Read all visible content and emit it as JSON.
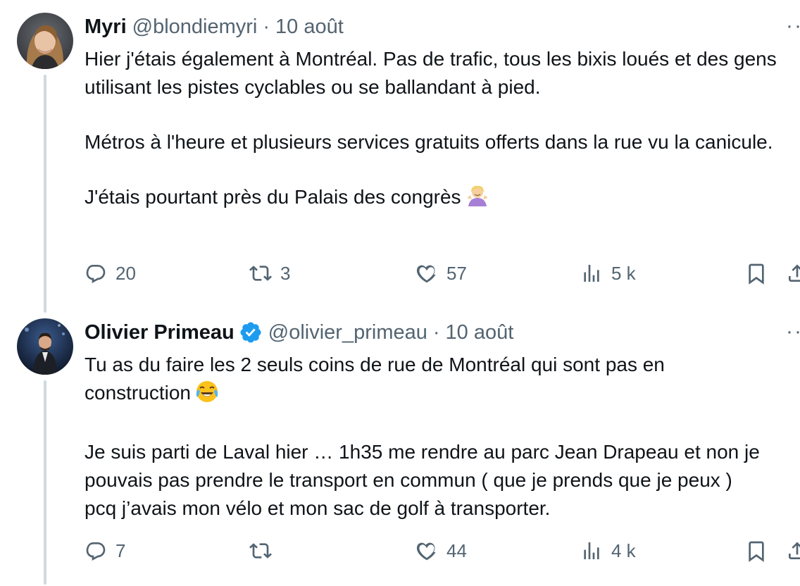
{
  "tweets": [
    {
      "display_name": "Myri",
      "handle": "@blondiemyri",
      "separator": "·",
      "date": "10 août",
      "verified": false,
      "avatar": "avatar-woman-photo",
      "more_icon": "··",
      "body": {
        "p1": "Hier j'étais également à Montréal. Pas de trafic, tous les bixis loués et des gens utilisant les pistes cyclables ou se ballandant à pied.",
        "p2": "Métros à l'heure et plusieurs services gratuits offerts dans la rue vu la canicule.",
        "p3": "J'étais pourtant près du Palais des congrès"
      },
      "emoji": "person-shrugging-emoji",
      "stats": {
        "replies": "20",
        "retweets": "3",
        "likes": "57",
        "views": "5 k"
      }
    },
    {
      "display_name": "Olivier Primeau",
      "handle": "@olivier_primeau",
      "separator": "·",
      "date": "10 août",
      "verified": true,
      "avatar": "avatar-man-suit-photo",
      "more_icon": "··",
      "body": {
        "p1a": "Tu as du faire les 2 seuls coins de rue de Montréal qui sont pas en",
        "p1b": "construction",
        "p2a": "Je suis parti de Laval hier … 1h35 me rendre au parc Jean Drapeau et non je",
        "p2b": "pouvais pas prendre le transport en commun ( que je prends que je peux )",
        "p2c": "pcq j’avais mon vélo et mon sac de golf à transporter."
      },
      "emoji": "face-with-tears-of-joy-emoji",
      "stats": {
        "replies": "7",
        "retweets": "",
        "likes": "44",
        "views": "4 k"
      }
    }
  ],
  "colors": {
    "text_primary": "#0f1419",
    "text_secondary": "#536471",
    "thread_line": "#cfd9de",
    "verified_badge": "#1d9bf0"
  },
  "icons": [
    "reply-icon",
    "retweet-icon",
    "like-icon",
    "views-icon",
    "bookmark-icon",
    "share-icon",
    "verified-badge-icon",
    "more-icon"
  ]
}
